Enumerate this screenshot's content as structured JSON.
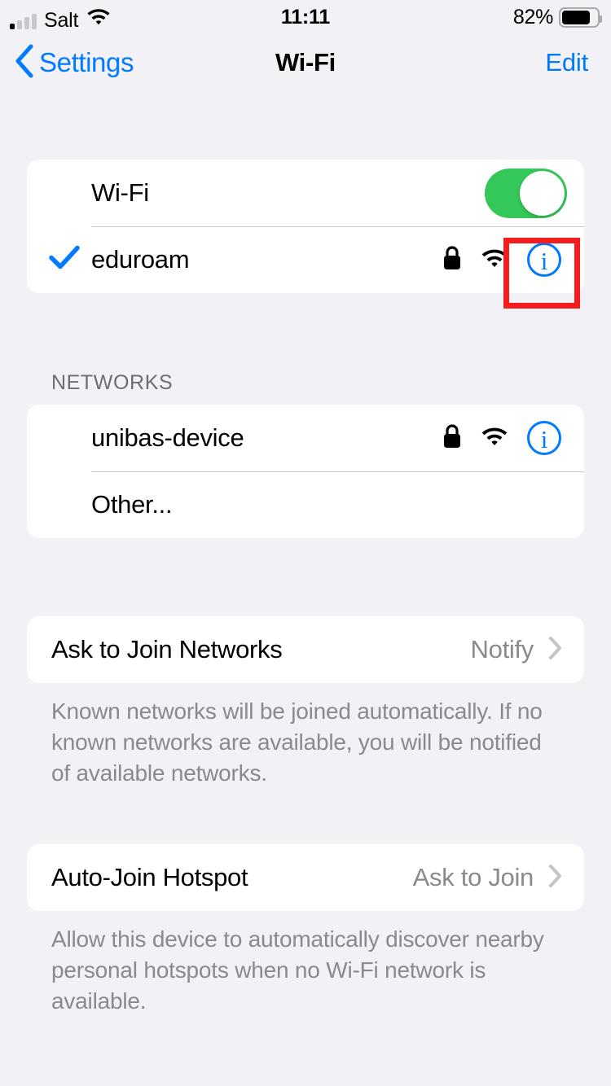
{
  "status_bar": {
    "carrier": "Salt",
    "time": "11:11",
    "battery_percent": "82%",
    "battery_level": 82,
    "signal_bars_filled": 1,
    "signal_bars_total": 4,
    "wifi_icon": "wifi-icon"
  },
  "nav": {
    "back_label": "Settings",
    "back_icon": "chevron-left-icon",
    "title": "Wi-Fi",
    "edit_label": "Edit"
  },
  "wifi_section": {
    "toggle_label": "Wi-Fi",
    "toggle_on": true,
    "connected_network": {
      "name": "eduroam",
      "connected": true,
      "secured": true,
      "signal": "strong",
      "info_label": "i"
    }
  },
  "networks_section": {
    "header": "NETWORKS",
    "items": [
      {
        "name": "unibas-device",
        "secured": true,
        "signal": "strong",
        "info_label": "i"
      }
    ],
    "other_label": "Other..."
  },
  "ask_to_join": {
    "label": "Ask to Join Networks",
    "value": "Notify",
    "footnote": "Known networks will be joined automatically. If no known networks are available, you will be notified of available networks."
  },
  "auto_join_hotspot": {
    "label": "Auto-Join Hotspot",
    "value": "Ask to Join",
    "footnote": "Allow this device to automatically discover nearby personal hotspots when no Wi-Fi network is available."
  },
  "annotation": {
    "type": "highlight-box",
    "target": "eduroam-info-button",
    "color": "#f41c1c"
  },
  "colors": {
    "accent_blue": "#007aff",
    "toggle_green": "#34c759",
    "background": "#f2f1f6",
    "card": "#ffffff",
    "secondary_text": "#8a8a8e",
    "separator": "#c6c6c8"
  }
}
